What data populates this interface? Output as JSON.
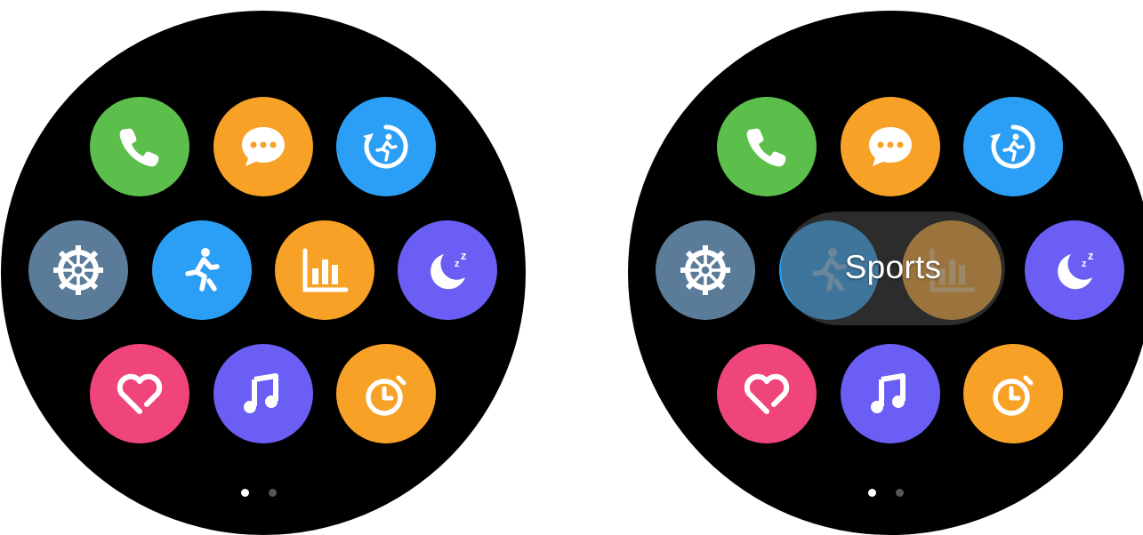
{
  "screens": [
    {
      "id": "home-grid",
      "apps": [
        {
          "id": "phone",
          "icon": "phone-icon",
          "color": "#5cbf4c"
        },
        {
          "id": "messages",
          "icon": "message-bubble-icon",
          "color": "#f7a126"
        },
        {
          "id": "workout-history",
          "icon": "running-history-icon",
          "color": "#2b9ff5"
        },
        {
          "id": "settings",
          "icon": "gear-icon",
          "color": "#5b7c99"
        },
        {
          "id": "sports",
          "icon": "running-person-icon",
          "color": "#2b9ff5"
        },
        {
          "id": "stats",
          "icon": "bar-chart-icon",
          "color": "#f7a126"
        },
        {
          "id": "sleep",
          "icon": "moon-zzz-icon",
          "color": "#6a5ef5"
        },
        {
          "id": "heart-rate",
          "icon": "heart-icon",
          "color": "#f0457a"
        },
        {
          "id": "music",
          "icon": "music-note-icon",
          "color": "#6a5ef5"
        },
        {
          "id": "timer",
          "icon": "stopwatch-icon",
          "color": "#f7a126"
        }
      ],
      "page_indicator": {
        "current": 1,
        "total": 2
      }
    },
    {
      "id": "home-grid-long-press",
      "tooltip": {
        "label": "Sports"
      },
      "page_indicator": {
        "current": 1,
        "total": 2
      }
    }
  ],
  "colors": {
    "dot_active": "#ffffff",
    "dot_inactive": "#555555"
  }
}
